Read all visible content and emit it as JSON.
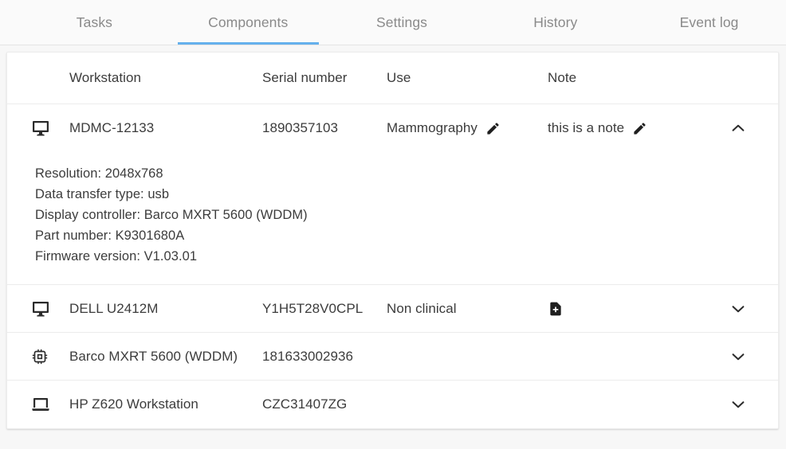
{
  "tabs": [
    {
      "label": "Tasks",
      "active": false
    },
    {
      "label": "Components",
      "active": true
    },
    {
      "label": "Settings",
      "active": false
    },
    {
      "label": "History",
      "active": false
    },
    {
      "label": "Event log",
      "active": false
    }
  ],
  "accent_color": "#64b0ec",
  "table": {
    "columns": [
      {
        "key": "device_icon",
        "label": ""
      },
      {
        "key": "workstation",
        "label": "Workstation"
      },
      {
        "key": "serial_number",
        "label": "Serial number"
      },
      {
        "key": "use",
        "label": "Use"
      },
      {
        "key": "note",
        "label": "Note"
      },
      {
        "key": "expander",
        "label": ""
      }
    ],
    "rows": [
      {
        "device_icon": "monitor-icon",
        "workstation": "MDMC-12133",
        "serial_number": "1890357103",
        "use": "Mammography",
        "use_edit_icon": "pencil-icon",
        "note": "this is a note",
        "note_edit_icon": "pencil-icon",
        "note_add_icon": "",
        "expanded": true,
        "expander_icon": "chevron-up-icon",
        "details": [
          "Resolution: 2048x768",
          "Data transfer type: usb",
          "Display controller: Barco MXRT 5600 (WDDM)",
          "Part number: K9301680A",
          "Firmware version: V1.03.01"
        ]
      },
      {
        "device_icon": "monitor-icon",
        "workstation": "DELL U2412M",
        "serial_number": "Y1H5T28V0CPL",
        "use": "Non clinical",
        "use_edit_icon": "",
        "note": "",
        "note_edit_icon": "",
        "note_add_icon": "note-add-icon",
        "expanded": false,
        "expander_icon": "chevron-down-icon",
        "details": []
      },
      {
        "device_icon": "chip-icon",
        "workstation": "Barco MXRT 5600 (WDDM)",
        "serial_number": "181633002936",
        "use": "",
        "use_edit_icon": "",
        "note": "",
        "note_edit_icon": "",
        "note_add_icon": "",
        "expanded": false,
        "expander_icon": "chevron-down-icon",
        "details": []
      },
      {
        "device_icon": "laptop-icon",
        "workstation": "HP Z620 Workstation",
        "serial_number": "CZC31407ZG",
        "use": "",
        "use_edit_icon": "",
        "note": "",
        "note_edit_icon": "",
        "note_add_icon": "",
        "expanded": false,
        "expander_icon": "chevron-down-icon",
        "details": []
      }
    ]
  }
}
